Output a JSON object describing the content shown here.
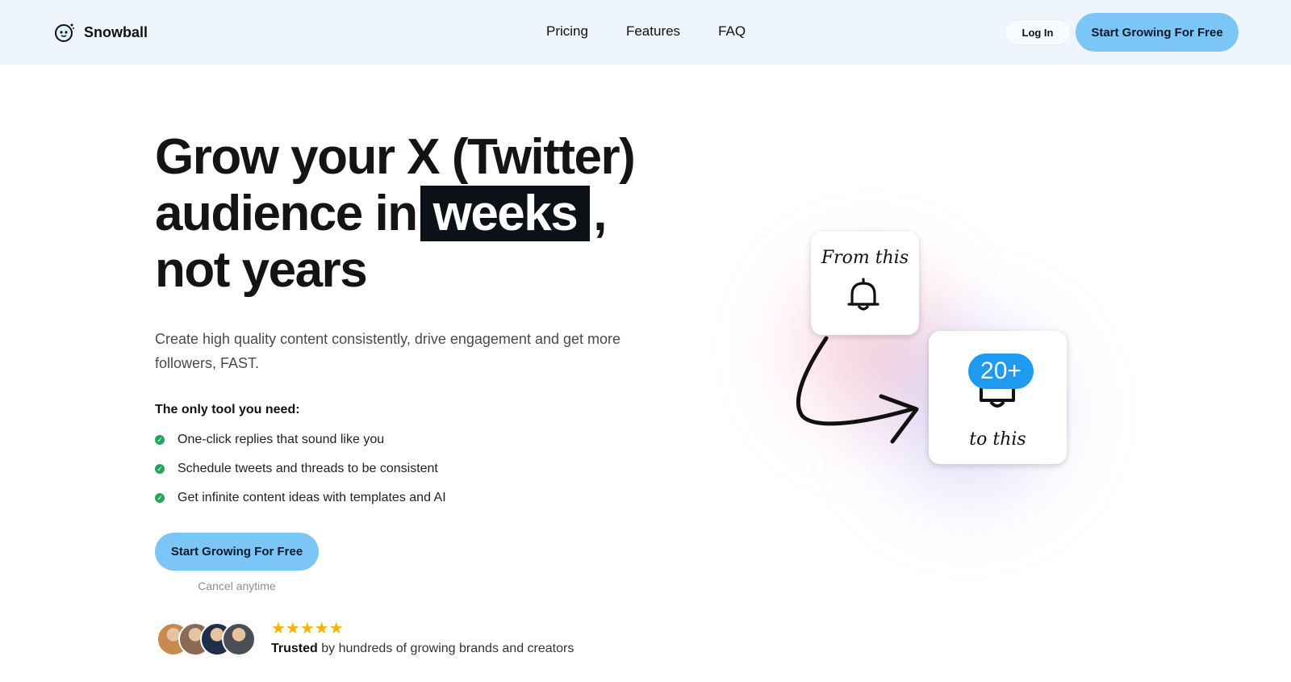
{
  "nav": {
    "brand": "Snowball",
    "links": [
      "Pricing",
      "Features",
      "FAQ"
    ],
    "login": "Log In",
    "cta": "Start Growing For Free"
  },
  "hero": {
    "title_line1": "Grow your X (Twitter)",
    "title_line2_pre": "audience in",
    "title_highlight": "weeks",
    "title_line2_post": ",",
    "title_line3": "not years",
    "subtitle": "Create high quality content consistently, drive engagement and get more followers, FAST.",
    "tools_heading": "The only tool you need:",
    "features": [
      "One-click replies that sound like you",
      "Schedule tweets and threads to be consistent",
      "Get infinite content ideas with templates and AI"
    ],
    "cta": "Start Growing For Free",
    "cancel_note": "Cancel anytime"
  },
  "social_proof": {
    "rating_stars": 5,
    "stars_text": "★★★★★",
    "trusted_bold": "Trusted",
    "trusted_rest": "by hundreds of growing brands and creators",
    "avatar_colors": [
      "#c68a4e",
      "#8b6a55",
      "#1f2f4a",
      "#4b4f55"
    ]
  },
  "illustration": {
    "from_label": "From this",
    "to_label": "to this",
    "badge": "20+"
  },
  "colors": {
    "nav_bg": "#eef5fd",
    "cta": "#7cc6f7",
    "highlight_bg": "#0b1117",
    "check": "#22a45d",
    "badge": "#1d9bf0",
    "stars": "#f4b400"
  }
}
